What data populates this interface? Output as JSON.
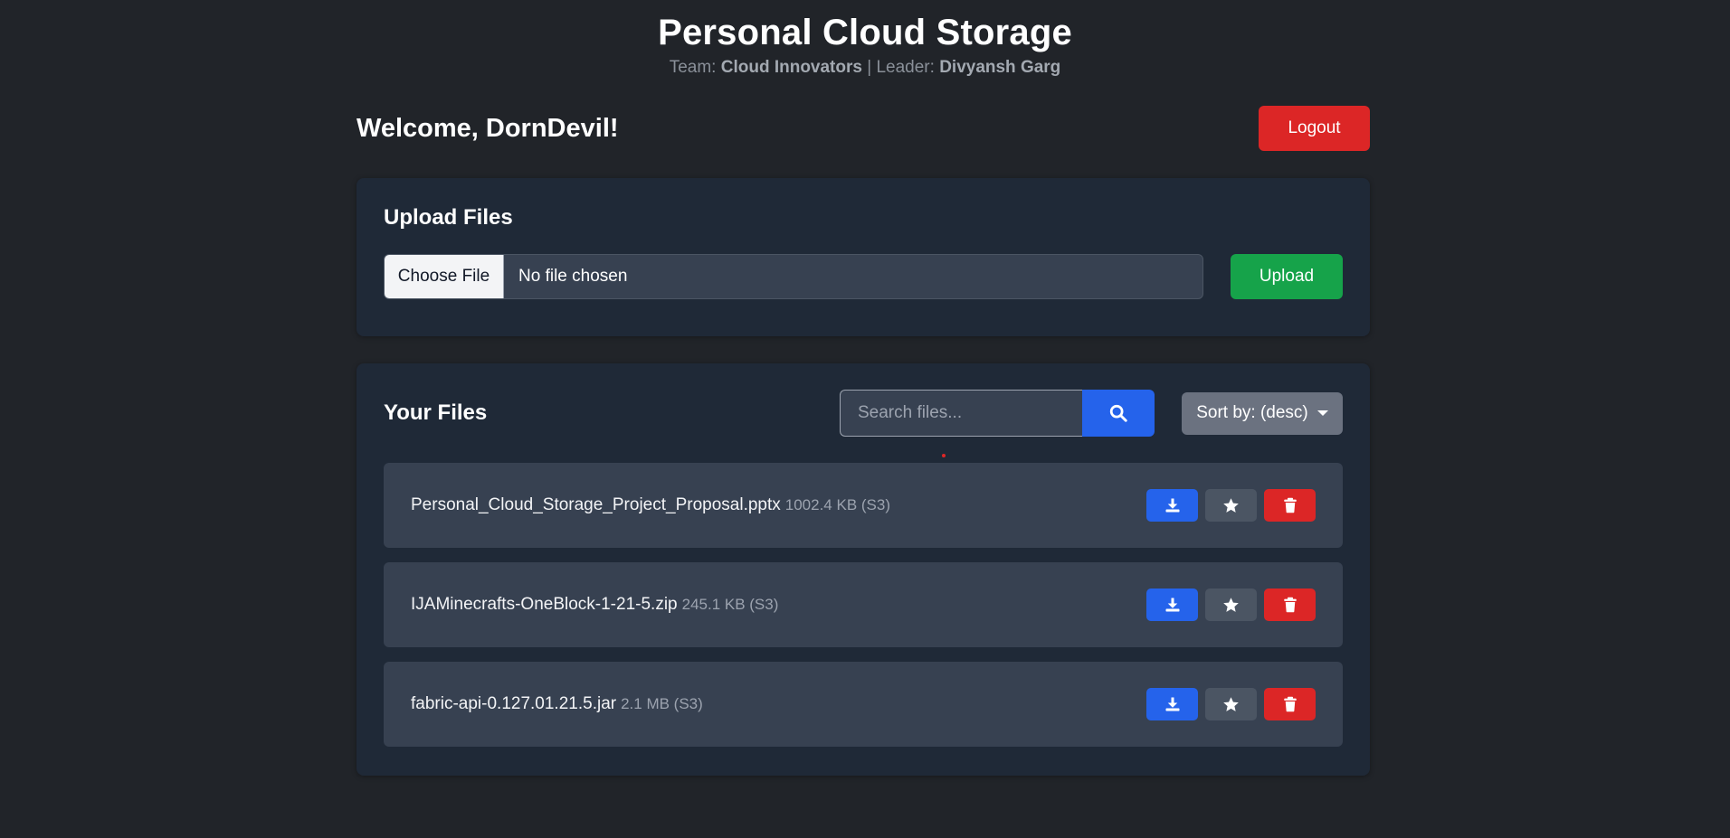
{
  "header": {
    "title": "Personal Cloud Storage",
    "team_prefix": "Team:",
    "team_name": "Cloud Innovators",
    "separator": "| Leader:",
    "leader_name": "Divyansh Garg"
  },
  "welcome": {
    "text": "Welcome, DornDevil!",
    "logout_label": "Logout"
  },
  "upload": {
    "title": "Upload Files",
    "choose_label": "Choose File",
    "no_file_text": "No file chosen",
    "upload_label": "Upload"
  },
  "files": {
    "title": "Your Files",
    "search_placeholder": "Search files...",
    "sort_label": "Sort by: (desc)",
    "items": [
      {
        "name": "Personal_Cloud_Storage_Project_Proposal.pptx",
        "meta": "1002.4 KB (S3)"
      },
      {
        "name": "IJAMinecrafts-OneBlock-1-21-5.zip",
        "meta": "245.1 KB (S3)"
      },
      {
        "name": "fabric-api-0.127.01.21.5.jar",
        "meta": "2.1 MB (S3)"
      }
    ]
  },
  "icons": {
    "search": "search-icon",
    "download": "download-icon",
    "star": "star-icon",
    "delete": "trash-icon",
    "sort_caret": "caret-down-icon"
  },
  "colors": {
    "background": "#212429",
    "card": "#1f2937",
    "row": "#374151",
    "primary": "#2563eb",
    "success": "#16a34a",
    "danger": "#dc2626",
    "secondary": "#6b7280"
  }
}
